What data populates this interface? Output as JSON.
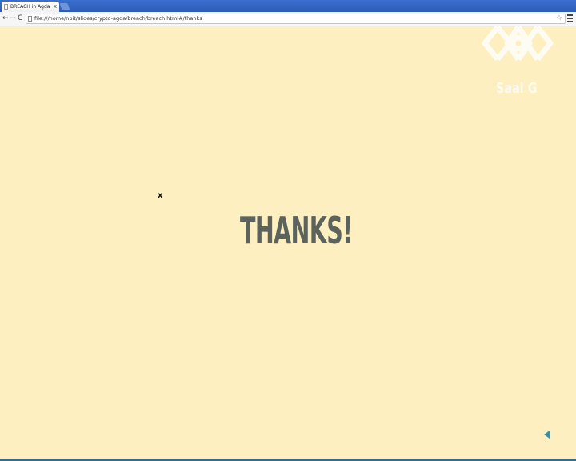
{
  "browser": {
    "tab_title": "BREACH in Agda",
    "tab_close": "x",
    "url": "file:///home/npit/slides/crypto-agda/breach/breach.html#/thanks",
    "back": "←",
    "forward": "→",
    "reload": "C",
    "star": "☆"
  },
  "slide": {
    "title": "THANKS!",
    "cursor_mark": "x"
  },
  "watermark": {
    "caption": "Saal G"
  },
  "colors": {
    "background": "#fdefc0",
    "title": "#5c625c",
    "accent": "#3a8fa8",
    "tabstrip": "#2d5bb4"
  }
}
